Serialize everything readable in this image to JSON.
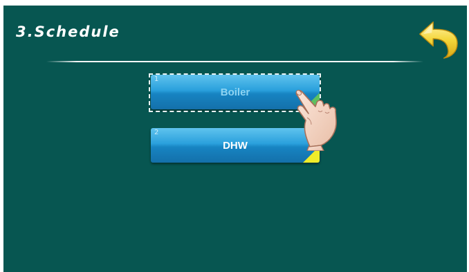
{
  "header": {
    "title": "3.Schedule"
  },
  "icons": {
    "back": "back-arrow-icon",
    "pointer": "hand-pointer-icon"
  },
  "menu": {
    "items": [
      {
        "number": "1",
        "label": "Boiler",
        "state": "focused",
        "corner_color": "#5cc060"
      },
      {
        "number": "2",
        "label": "DHW",
        "state": "normal",
        "corner_color": "#f0ec2a"
      }
    ]
  },
  "colors": {
    "background": "#075651",
    "button": "#2aa0dc",
    "back_arrow": "#f2d23a"
  }
}
